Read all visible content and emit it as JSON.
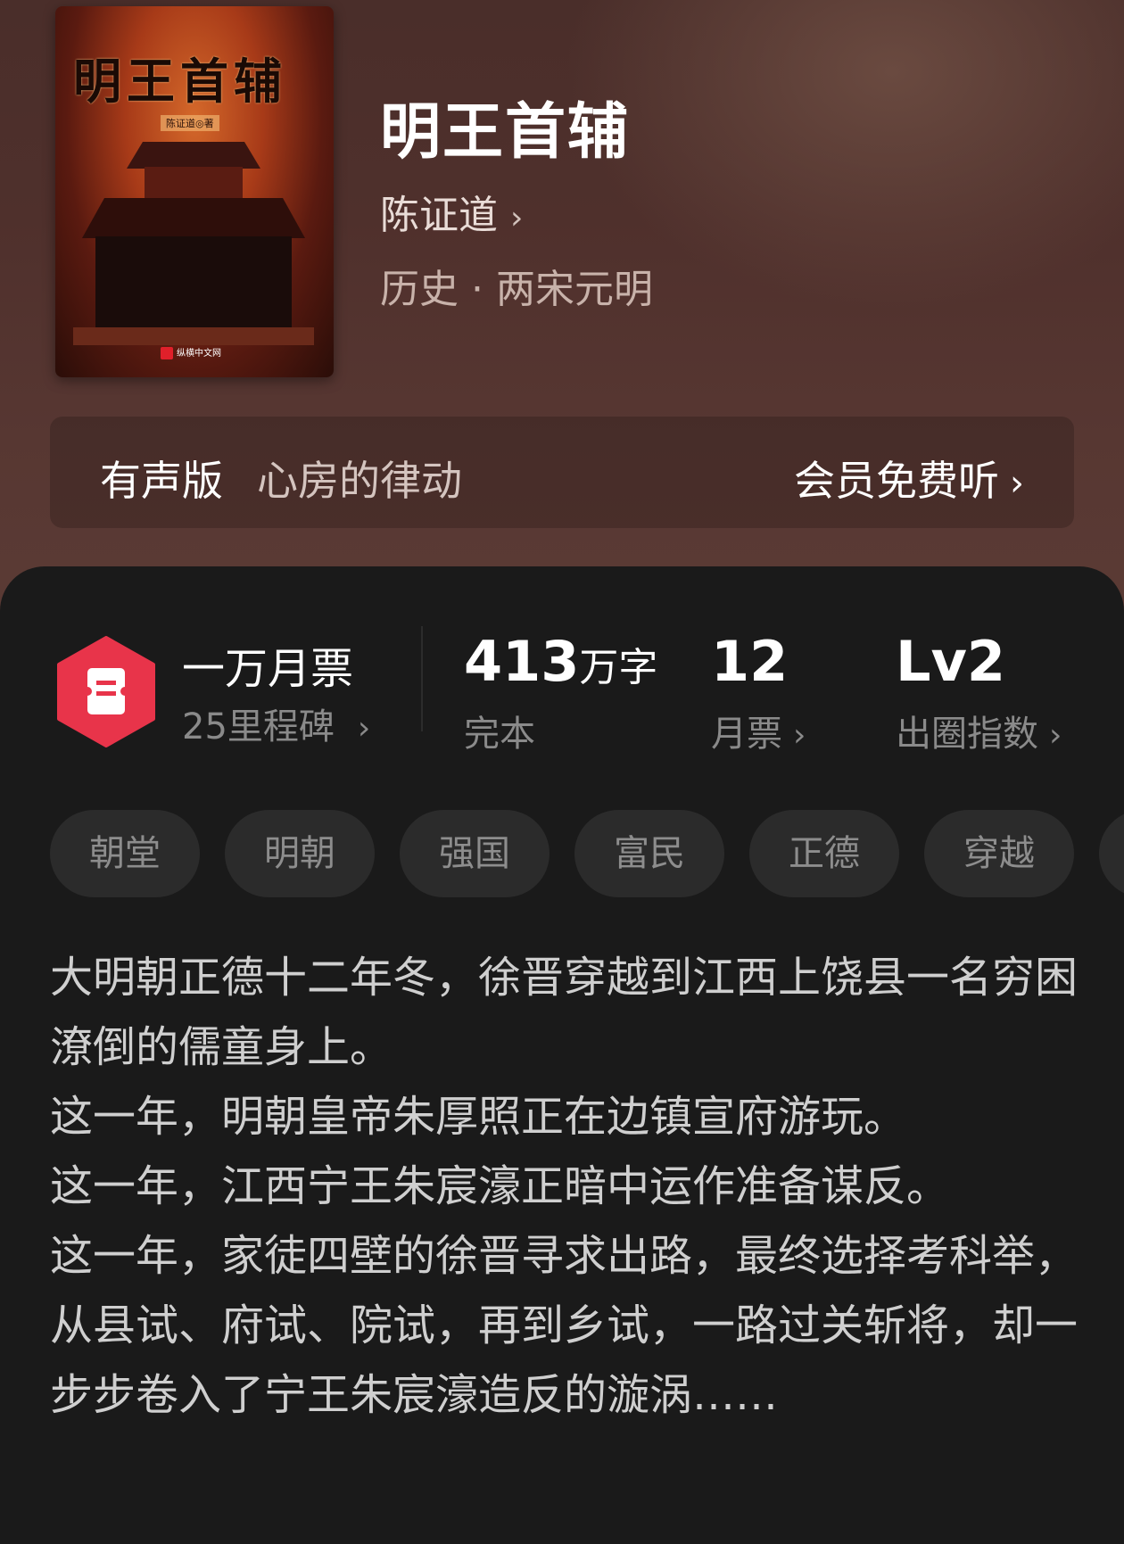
{
  "book": {
    "cover_title": "明王首辅",
    "cover_author": "陈证道◎著",
    "cover_publisher": "纵横中文网",
    "title": "明王首辅",
    "author": "陈证道",
    "genre": "历史 · 两宋元明"
  },
  "audio": {
    "label": "有声版",
    "narrator": "心房的律动",
    "cta": "会员免费听"
  },
  "stats": {
    "tickets_title": "一万月票",
    "tickets_sub": "25里程碑",
    "words_value": "413",
    "words_unit": "万字",
    "words_sub": "完本",
    "monthly_value": "12",
    "monthly_sub": "月票",
    "level_value": "Lv2",
    "level_sub": "出圈指数"
  },
  "tags": [
    "朝堂",
    "明朝",
    "强国",
    "富民",
    "正德",
    "穿越",
    ""
  ],
  "synopsis": [
    "大明朝正德十二年冬，徐晋穿越到江西上饶县一名穷困潦倒的儒童身上。",
    "这一年，明朝皇帝朱厚照正在边镇宣府游玩。",
    "这一年，江西宁王朱宸濠正暗中运作准备谋反。",
    "这一年，家徒四壁的徐晋寻求出路，最终选择考科举，从县试、府试、院试，再到乡试，一路过关斩将，却一步步卷入了宁王朱宸濠造反的漩涡……"
  ],
  "colors": {
    "header_bg": "#4f302c",
    "panel_bg": "#1a1a1a",
    "ticket_red": "#e8344a",
    "tag_bg": "#2b2b2b"
  },
  "icons": [
    "chevron-right-icon",
    "ticket-icon"
  ]
}
